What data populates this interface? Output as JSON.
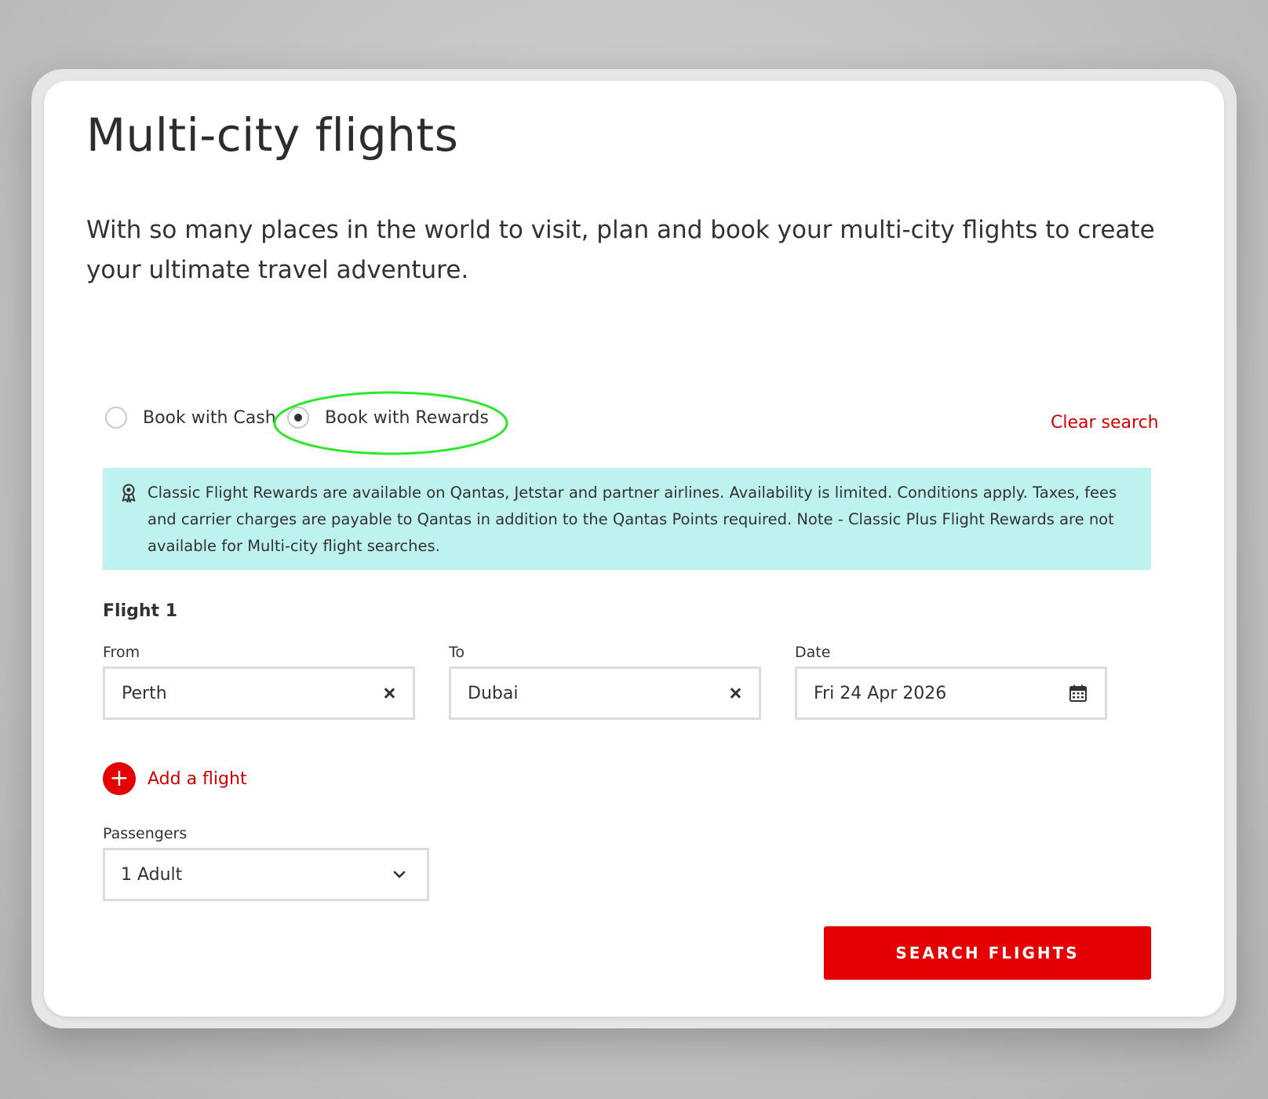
{
  "page": {
    "title": "Multi-city flights",
    "intro": "With so many places in the world to visit, plan and book your multi-city flights to create your ultimate travel adventure."
  },
  "booking_type": {
    "options": [
      {
        "label": "Book with Cash",
        "selected": false
      },
      {
        "label": "Book with Rewards",
        "selected": true
      }
    ],
    "clear_search_label": "Clear search"
  },
  "info_banner": {
    "icon": "award-ribbon-icon",
    "text": "Classic Flight Rewards are available on Qantas, Jetstar and partner airlines. Availability is limited. Conditions apply. Taxes, fees and carrier charges are payable to Qantas in addition to the Qantas Points required. Note - Classic Plus Flight Rewards are not available for Multi-city flight searches."
  },
  "flights": [
    {
      "heading": "Flight 1",
      "from": {
        "label": "From",
        "value": "Perth"
      },
      "to": {
        "label": "To",
        "value": "Dubai"
      },
      "date": {
        "label": "Date",
        "value": "Fri 24 Apr 2026"
      }
    }
  ],
  "add_flight_label": "Add a flight",
  "passengers": {
    "label": "Passengers",
    "value": "1 Adult"
  },
  "search_button_label": "SEARCH FLIGHTS",
  "colors": {
    "brand_red": "#e40000",
    "link_red": "#d30000",
    "info_banner_bg": "#bef2ef",
    "highlight_green": "#2ee82e",
    "text": "#323232"
  }
}
